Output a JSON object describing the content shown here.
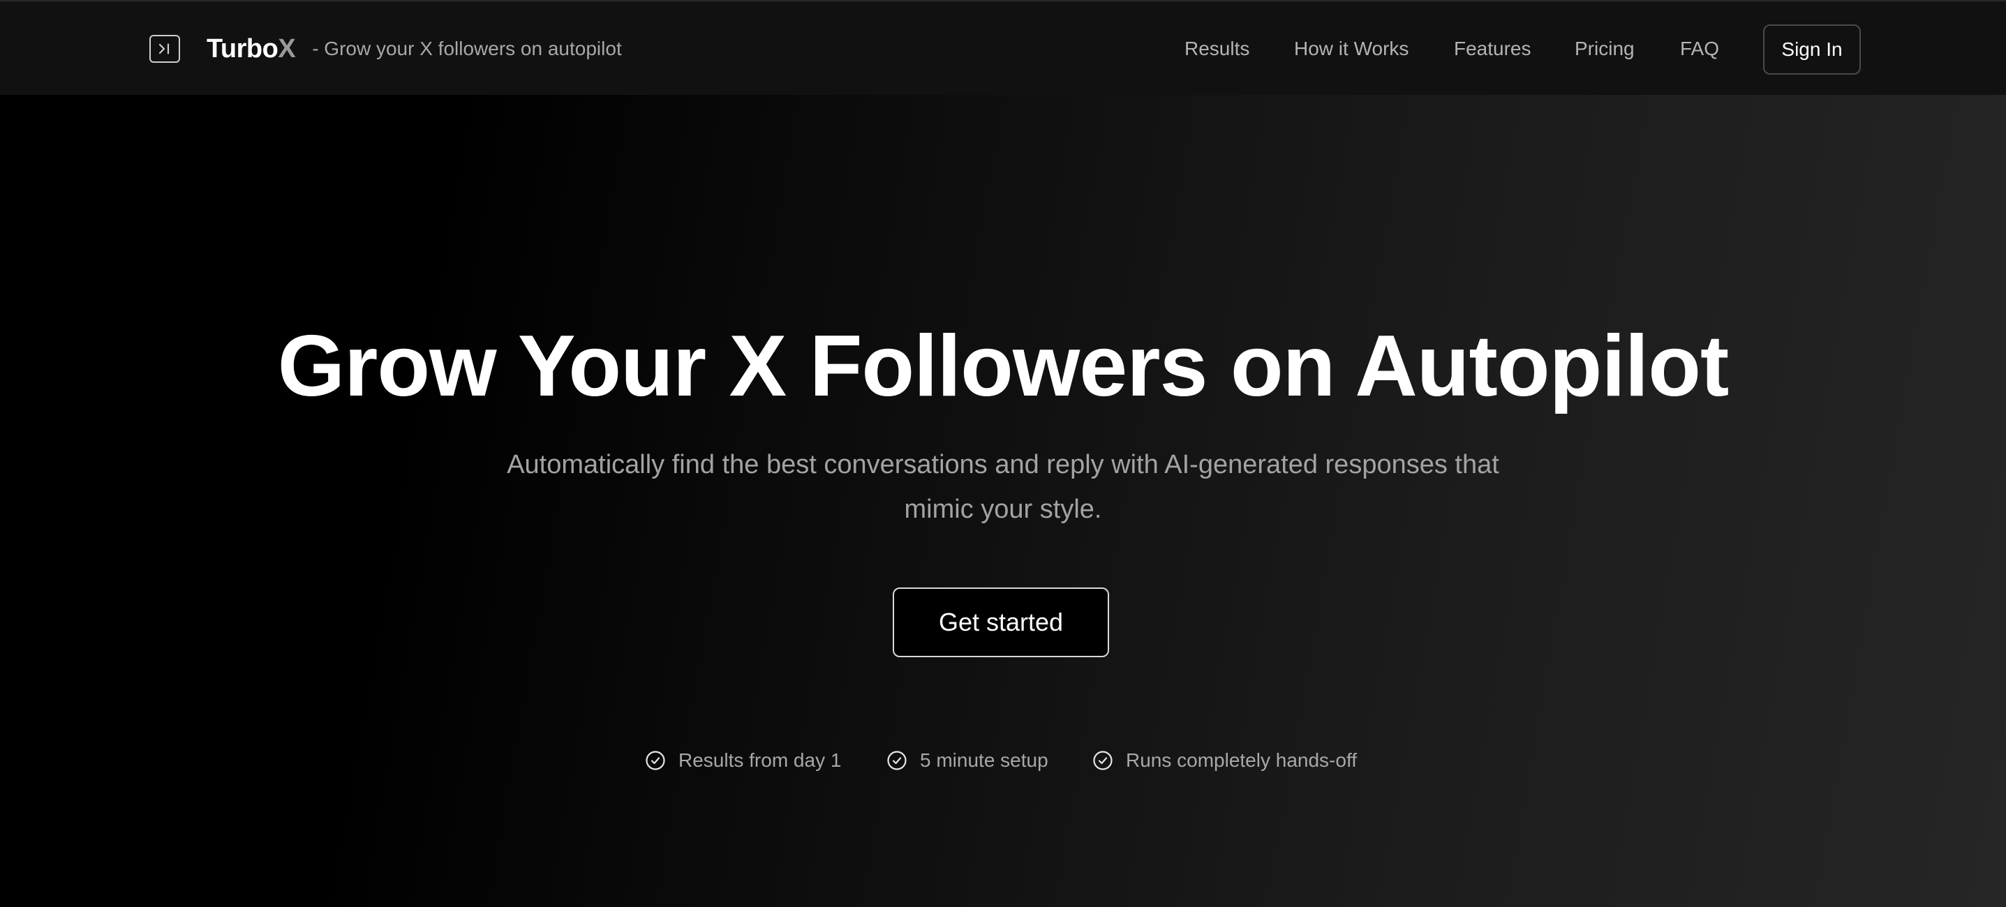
{
  "header": {
    "brand_name": "Turbo",
    "brand_accent": "X",
    "tagline": "- Grow your X followers on autopilot",
    "nav": [
      "Results",
      "How it Works",
      "Features",
      "Pricing",
      "FAQ"
    ],
    "signin_label": "Sign In",
    "logo_icon": "sidebar-toggle-icon"
  },
  "hero": {
    "title": "Grow Your X Followers on Autopilot",
    "subtitle_line1": "Automatically find the best conversations and reply with AI-generated responses that",
    "subtitle_line2": "mimic your style.",
    "cta_label": "Get started",
    "features": [
      "Results from day 1",
      "5 minute setup",
      "Runs completely hands-off"
    ],
    "feature_icon": "check-circle-icon"
  },
  "colors": {
    "background": "#000000",
    "navbar": "#111111",
    "text_primary": "#ffffff",
    "text_muted": "#a8a8a8",
    "brand_accent": "#9a9a9a"
  }
}
